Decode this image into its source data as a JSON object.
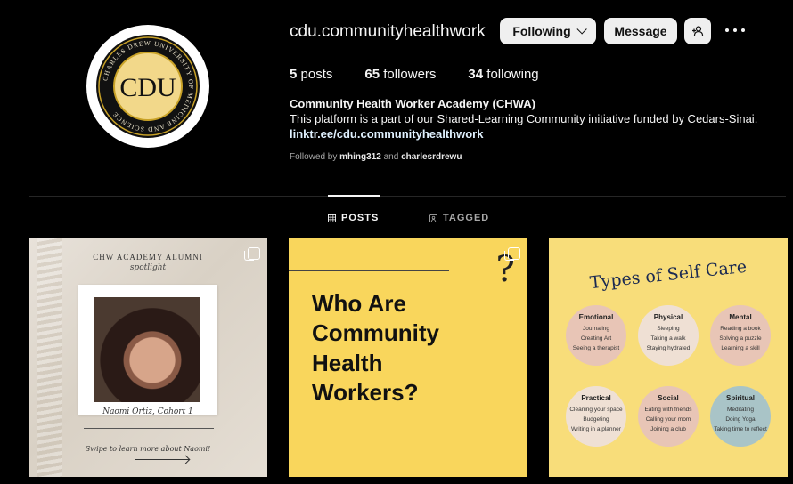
{
  "profile": {
    "username": "cdu.communityhealthwork",
    "logo_text": "CDU",
    "logo_ring_text": "CHARLES DREW UNIVERSITY OF MEDICINE AND SCIENCE",
    "following_label": "Following",
    "message_label": "Message",
    "stats": {
      "posts_count": "5",
      "posts_label": "posts",
      "followers_count": "65",
      "followers_label": "followers",
      "following_count": "34",
      "following_label": "following"
    },
    "full_name": "Community Health Worker Academy (CHWA)",
    "bio": "This platform is a part of our Shared-Learning Community initiative funded by Cedars-Sinai.",
    "link": "linktr.ee/cdu.communityhealthwork",
    "followed_by_prefix": "Followed by",
    "followed_by_user1": "mhing312",
    "followed_by_and": "and",
    "followed_by_user2": "charlesrdrewu"
  },
  "tabs": [
    {
      "label": "POSTS",
      "icon": "grid-icon",
      "active": true
    },
    {
      "label": "TAGGED",
      "icon": "tag-icon",
      "active": false
    }
  ],
  "posts": [
    {
      "title": "CHW ACADEMY ALUMNI",
      "subtitle": "spotlight",
      "name": "Naomi Ortiz, Cohort 1",
      "swipe": "Swipe to learn more about Naomi!"
    },
    {
      "lines": [
        "Who Are",
        "Community",
        "Health",
        "Workers?"
      ],
      "question_mark": "?"
    },
    {
      "title": "Types of Self Care",
      "circles": [
        {
          "title": "Emotional",
          "items": [
            "Journaling",
            "Creating Art",
            "Seeing a therapist"
          ]
        },
        {
          "title": "Physical",
          "items": [
            "Sleeping",
            "Taking a walk",
            "Staying hydrated"
          ]
        },
        {
          "title": "Mental",
          "items": [
            "Reading a book",
            "Solving a puzzle",
            "Learning a skill"
          ]
        },
        {
          "title": "Practical",
          "items": [
            "Cleaning your space",
            "Budgeting",
            "Writing in a planner"
          ]
        },
        {
          "title": "Social",
          "items": [
            "Eating with friends",
            "Calling your mom",
            "Joining a club"
          ]
        },
        {
          "title": "Spiritual",
          "items": [
            "Meditating",
            "Doing Yoga",
            "Taking time to reflect"
          ]
        }
      ]
    }
  ],
  "colors": {
    "background": "#000000",
    "button_bg": "#efefef",
    "link": "#e0f1ff",
    "post2_bg": "#f9d65c",
    "post3_bg": "#f8dd7a"
  }
}
